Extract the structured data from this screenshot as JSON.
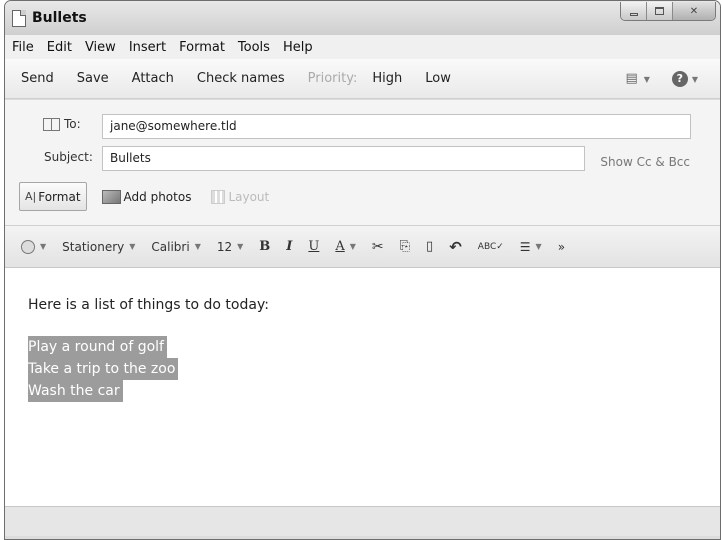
{
  "window": {
    "title": "Bullets"
  },
  "menu": {
    "items": [
      "File",
      "Edit",
      "View",
      "Insert",
      "Format",
      "Tools",
      "Help"
    ]
  },
  "toolbar": {
    "send": "Send",
    "save": "Save",
    "attach": "Attach",
    "check_names": "Check names",
    "priority": "Priority:",
    "high": "High",
    "low": "Low"
  },
  "fields": {
    "to_label": "To:",
    "to_value": "jane@somewhere.tld",
    "subject_label": "Subject:",
    "subject_value": "Bullets",
    "show_cc_bcc": "Show Cc & Bcc"
  },
  "format_bar": {
    "format": "Format",
    "add_photos": "Add photos",
    "layout": "Layout"
  },
  "formatting": {
    "stationery": "Stationery",
    "font": "Calibri",
    "size": "12"
  },
  "message": {
    "intro": "Here is a list of things to do today:",
    "items": [
      "Play a round of golf",
      "Take a trip to the zoo",
      "Wash the car"
    ]
  },
  "colors": {
    "selection": "#9c9c9c",
    "disabled_text": "#aaaaaa"
  }
}
